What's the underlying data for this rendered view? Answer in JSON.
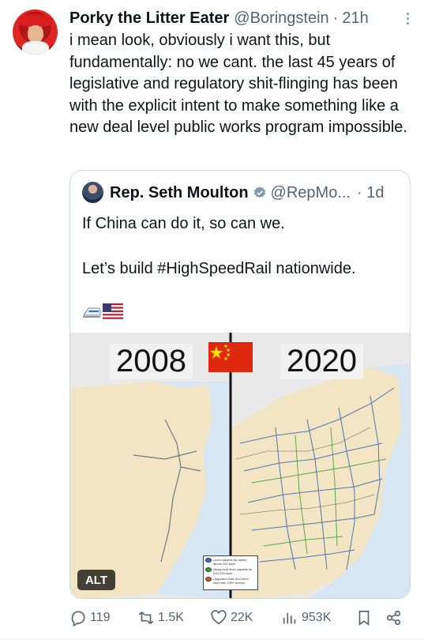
{
  "tweet": {
    "author_name": "Porky the Litter Eater",
    "handle": "@Boringstein",
    "separator": "·",
    "time": "21h",
    "text": "i mean look, obviously i want this, but fundamentally: no we cant. the last 45 years of legislative and regulatory shit-flinging has been with the explicit intent to make something like a new deal level public works program impossible."
  },
  "quote": {
    "author_name": "Rep. Seth Moulton",
    "handle": "@RepMo...",
    "time": "· 1d",
    "line1": "If China can do it, so can we.",
    "line2": "Let’s build #HighSpeedRail nationwide.",
    "image": {
      "year_left": "2008",
      "year_right": "2020",
      "alt_label": "ALT",
      "legend": [
        {
          "text": "Lines capable for speed above 200 km/h",
          "color": "#2f6fd6"
        },
        {
          "text": "Newly built lines capable for 200-295 km/h",
          "color": "#3a9e3a"
        },
        {
          "text": "Upgraded lines and other lines with CRH service",
          "color": "#e0531d"
        }
      ]
    }
  },
  "actions": {
    "replies": "119",
    "retweets": "1.5K",
    "likes": "22K",
    "views": "953K"
  },
  "icons": {
    "more": "more-dots-icon",
    "verified": "verified-badge-icon",
    "reply": "reply-icon",
    "retweet": "retweet-icon",
    "like": "heart-icon",
    "views": "views-bar-icon",
    "bookmark": "bookmark-icon",
    "share": "share-icon"
  },
  "colors": {
    "text": "#0f1419",
    "muted": "#536471",
    "border": "#cfd9de",
    "china_flag": "#de2910"
  }
}
